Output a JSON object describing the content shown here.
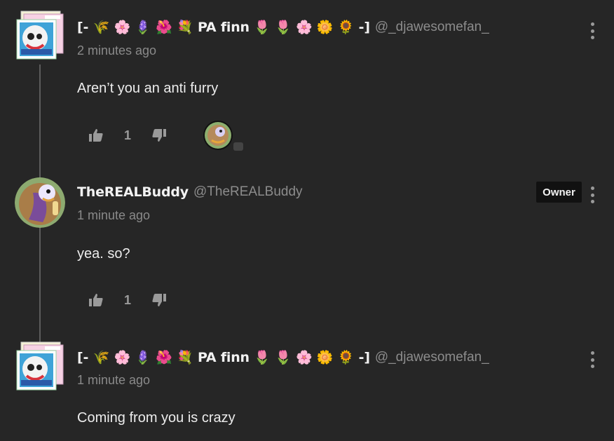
{
  "comments": [
    {
      "author": "[- 🌾 🌸 🪻 🌺 💐 PA finn 🌷 🌷 🌸 🌼 🌻 -]",
      "handle": "@_djawesomefan_",
      "timestamp": "2 minutes ago",
      "text": "Aren’t you an anti furry",
      "likes": "1",
      "has_reply_avatar": true
    },
    {
      "author": "TheREALBuddy",
      "handle": "@TheREALBuddy",
      "timestamp": "1 minute ago",
      "text": "yea. so?",
      "likes": "1",
      "badge": "Owner"
    },
    {
      "author": "[- 🌾 🌸 🪻 🌺 💐 PA finn 🌷 🌷 🌸 🌼 🌻 -]",
      "handle": "@_djawesomefan_",
      "timestamp": "1 minute ago",
      "text": "Coming from you is crazy"
    }
  ],
  "icons": {
    "like": "thumbs-up-icon",
    "dislike": "thumbs-down-icon",
    "menu": "more-vertical-icon"
  },
  "colors": {
    "background": "#262626",
    "thread_line": "#5c5c5c",
    "badge_bg": "#111111"
  }
}
